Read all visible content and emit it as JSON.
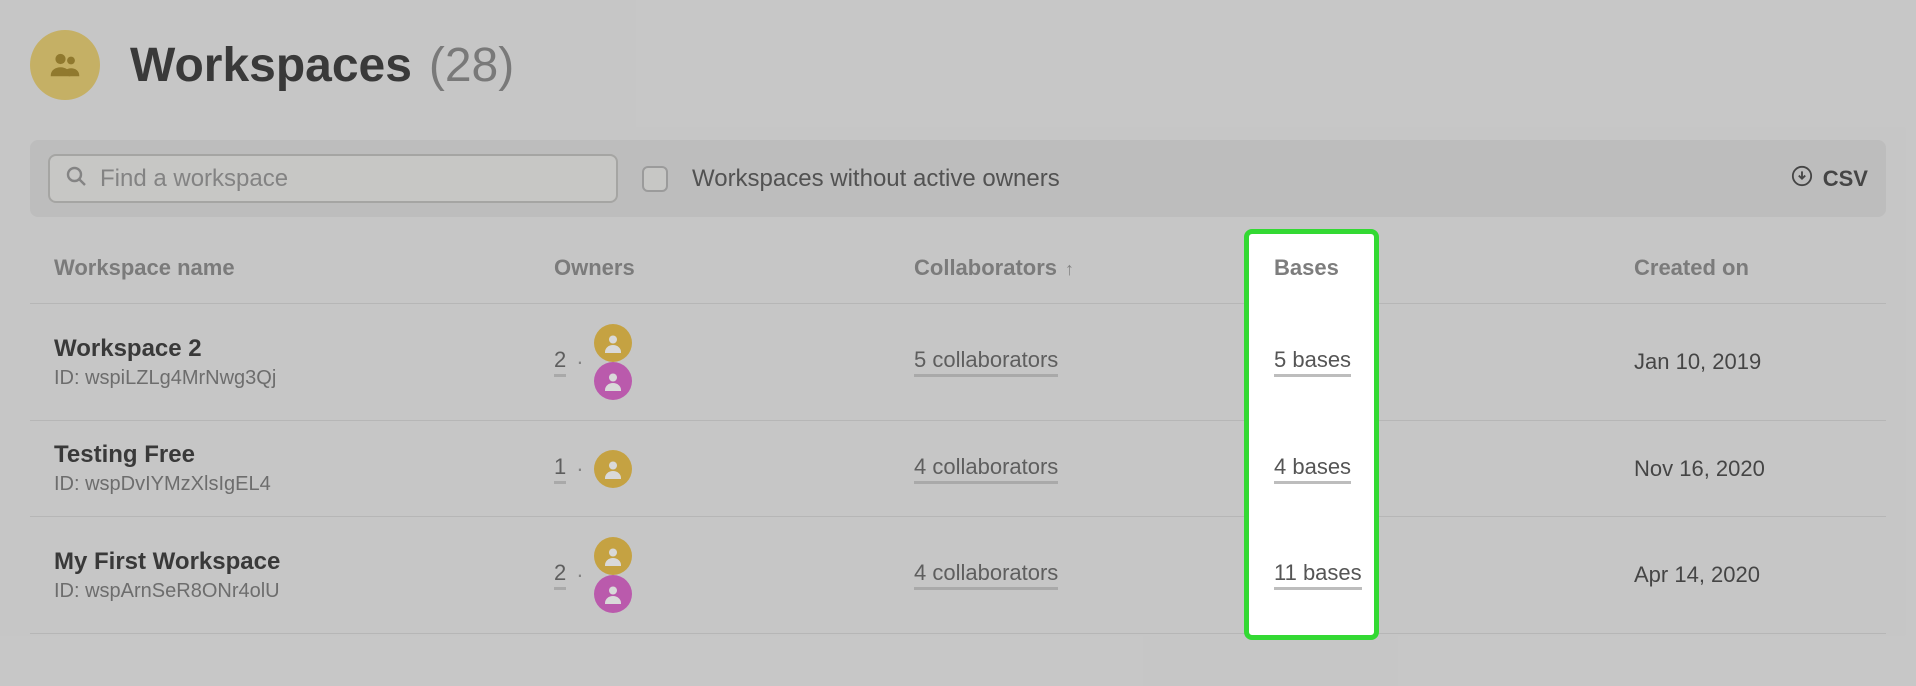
{
  "header": {
    "title": "Workspaces",
    "count_display": "(28)"
  },
  "toolbar": {
    "search_placeholder": "Find a workspace",
    "filter_label": "Workspaces without active owners",
    "csv_label": "CSV"
  },
  "columns": {
    "name": "Workspace name",
    "owners": "Owners",
    "collaborators": "Collaborators",
    "bases": "Bases",
    "created": "Created on"
  },
  "rows": [
    {
      "name": "Workspace 2",
      "id_label": "ID: wspiLZLg4MrNwg3Qj",
      "owner_count": "2",
      "owner_avatars": [
        "gold",
        "magenta"
      ],
      "collaborators": "5 collaborators",
      "bases": "5 bases",
      "created": "Jan 10, 2019"
    },
    {
      "name": "Testing Free",
      "id_label": "ID: wspDvIYMzXlsIgEL4",
      "owner_count": "1",
      "owner_avatars": [
        "gold"
      ],
      "collaborators": "4 collaborators",
      "bases": "4 bases",
      "created": "Nov 16, 2020"
    },
    {
      "name": "My First Workspace",
      "id_label": "ID: wspArnSeR8ONr4olU",
      "owner_count": "2",
      "owner_avatars": [
        "gold",
        "magenta"
      ],
      "collaborators": "4 collaborators",
      "bases": "11 bases",
      "created": "Apr 14, 2020"
    }
  ]
}
